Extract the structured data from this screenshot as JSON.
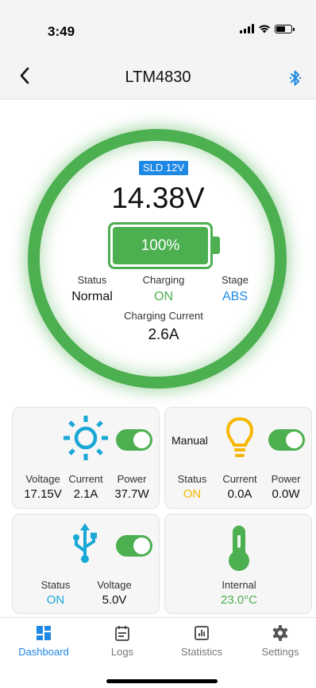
{
  "status_bar": {
    "time": "3:49"
  },
  "header": {
    "title": "LTM4830",
    "back_icon": "chevron-left-icon",
    "bluetooth_icon": "bluetooth-icon"
  },
  "battery": {
    "type_badge": "SLD 12V",
    "voltage": "14.38V",
    "level_text": "100%",
    "level_fraction": 1.0,
    "status_label": "Status",
    "status_value": "Normal",
    "charging_label": "Charging",
    "charging_value": "ON",
    "stage_label": "Stage",
    "stage_value": "ABS",
    "current_label": "Charging Current",
    "current_value": "2.6A"
  },
  "solar": {
    "icon": "sun-icon",
    "toggle_on": true,
    "voltage_label": "Voltage",
    "voltage_value": "17.15V",
    "current_label": "Current",
    "current_value": "2.1A",
    "power_label": "Power",
    "power_value": "37.7W"
  },
  "load": {
    "mode_label": "Manual",
    "icon": "lightbulb-icon",
    "toggle_on": true,
    "status_label": "Status",
    "status_value": "ON",
    "current_label": "Current",
    "current_value": "0.0A",
    "power_label": "Power",
    "power_value": "0.0W"
  },
  "usb": {
    "icon": "usb-icon",
    "toggle_on": true,
    "status_label": "Status",
    "status_value": "ON",
    "voltage_label": "Voltage",
    "voltage_value": "5.0V"
  },
  "temperature": {
    "icon": "thermometer-icon",
    "internal_label": "Internal",
    "internal_value": "23.0°C"
  },
  "tabs": [
    {
      "label": "Dashboard",
      "icon": "dashboard-icon",
      "active": true
    },
    {
      "label": "Logs",
      "icon": "calendar-icon",
      "active": false
    },
    {
      "label": "Statistics",
      "icon": "chart-icon",
      "active": false
    },
    {
      "label": "Settings",
      "icon": "gear-icon",
      "active": false
    }
  ],
  "colors": {
    "green": "#4caf50",
    "blue": "#1e88e5",
    "yellow": "#f6b700",
    "cyan": "#1aa7d6"
  }
}
